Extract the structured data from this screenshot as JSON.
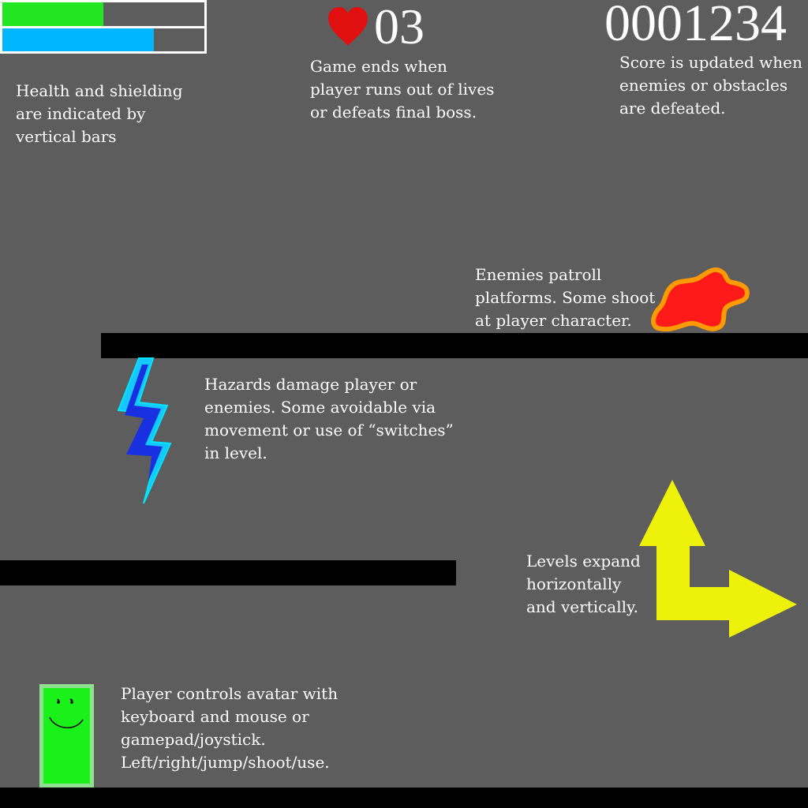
{
  "hud": {
    "health_level": 0.5,
    "shield_level": 0.75,
    "health_color": "#22e622",
    "shield_color": "#00b7ff",
    "lives_icon": "heart-icon",
    "lives": "03",
    "score": "0001234"
  },
  "annotations": {
    "bars_note": "Health and shielding\nare indicated by\nvertical bars",
    "lives_note": "Game ends when\nplayer runs out of lives\nor defeats final boss.",
    "score_note": "Score is updated when\nenemies or obstacles\nare defeated.",
    "enemy_note": "Enemies patroll\nplatforms. Some shoot\nat player character.",
    "hazard_note": "Hazards damage player or\nenemies. Some avoidable via\nmovement or use of “switches”\nin level.",
    "level_note": "Levels expand\nhorizontally\nand vertically.",
    "player_note": "Player controls avatar with\nkeyboard and mouse or\ngamepad/joystick.\nLeft/right/jump/shoot/use."
  },
  "sprites": {
    "enemy": "red-splat-enemy-icon",
    "hazard": "lightning-bolt-icon",
    "arrows": "expand-arrows-icon",
    "player": "green-block-player-icon"
  }
}
